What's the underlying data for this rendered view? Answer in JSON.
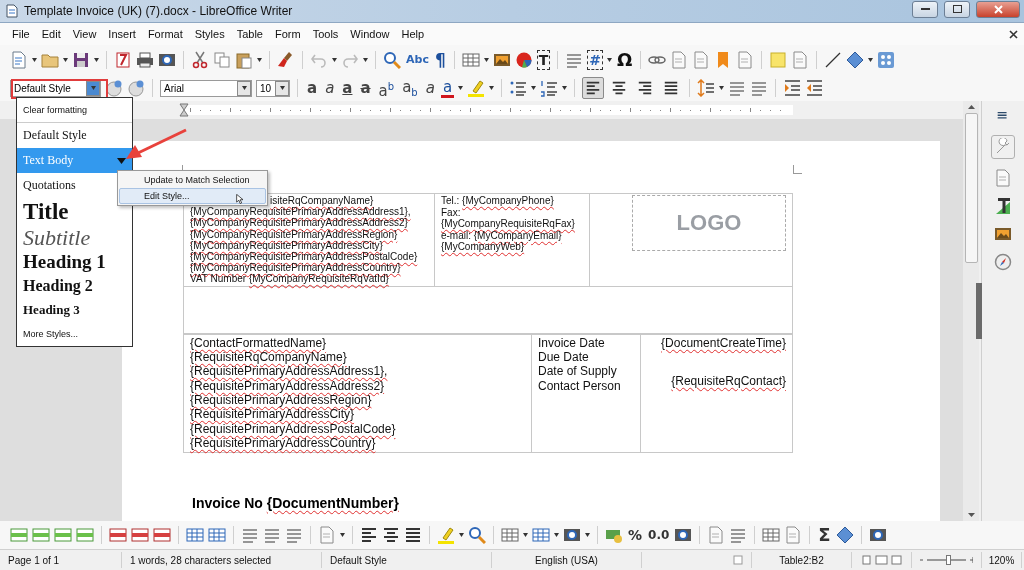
{
  "window": {
    "title": "Template Invoice (UK) (7).docx - LibreOffice Writer"
  },
  "menu": [
    "File",
    "Edit",
    "View",
    "Insert",
    "Format",
    "Styles",
    "Table",
    "Form",
    "Tools",
    "Window",
    "Help"
  ],
  "toolbar_glyphs": [
    "Abc",
    "¶",
    "T",
    "#",
    "Ω"
  ],
  "formatting": {
    "style": "Default Style",
    "style_open": true,
    "font": "Arial",
    "size": "10"
  },
  "format_buttons": [
    {
      "kind": "bold",
      "glyph": "a"
    },
    {
      "kind": "italic",
      "glyph": "a"
    },
    {
      "kind": "underline",
      "glyph": "a"
    },
    {
      "kind": "strike",
      "glyph": "a"
    },
    {
      "kind": "script",
      "glyph": "a$^{b}$"
    },
    {
      "kind": "script",
      "glyph": "a$_{b}$"
    },
    {
      "kind": "clear",
      "glyph": "a"
    },
    {
      "kind": "color",
      "glyph": "a"
    }
  ],
  "align_buttons": [
    {
      "kind": "left",
      "selected": true
    },
    {
      "kind": "center",
      "selected": false
    },
    {
      "kind": "right",
      "selected": false
    },
    {
      "kind": "justify",
      "selected": false
    }
  ],
  "styles_menu": [
    {
      "label": "Clear formatting",
      "kind": "action",
      "selected": false
    },
    {
      "label": "Default Style",
      "kind": "plain",
      "selected": false
    },
    {
      "label": "Text Body",
      "kind": "plain",
      "selected": true
    },
    {
      "label": "Quotations",
      "kind": "plain",
      "selected": false
    },
    {
      "label": "Title",
      "kind": "title",
      "selected": false
    },
    {
      "label": "Subtitle",
      "kind": "subtitle",
      "selected": false
    },
    {
      "label": "Heading 1",
      "kind": "h1",
      "selected": false
    },
    {
      "label": "Heading 2",
      "kind": "h2",
      "selected": false
    },
    {
      "label": "Heading 3",
      "kind": "h3",
      "selected": false
    },
    {
      "label": "More Styles...",
      "kind": "action",
      "selected": false
    }
  ],
  "context_menu": [
    {
      "label": "Update to Match Selection",
      "selected": false
    },
    {
      "label": "Edit Style...",
      "selected": true
    }
  ],
  "document": {
    "company_lines": [
      {
        "field": "isiteRqCompanyName}",
        "kind": "partial"
      },
      {
        "field": "{MyCompanyRequisitePrimaryAddressAddress1},"
      },
      {
        "field": "{MyCompanyRequisitePrimaryAddressAddress2}"
      },
      {
        "field": "{MyCompanyRequisitePrimaryAddressRegion}"
      },
      {
        "field": "{MyCompanyRequisitePrimaryAddressCity}"
      },
      {
        "field": "{MyCompanyRequisitePrimaryAddressPostalCode}"
      },
      {
        "field": "{MyCompanyRequisitePrimaryAddressCountry}"
      },
      {
        "label": "VAT Number ",
        "field": "{MyCompanyRequisiteRqVatId}"
      }
    ],
    "contact_lines": [
      {
        "label": "Tel.: ",
        "field": "{MyCompanyPhone}"
      },
      {
        "label": "Fax:"
      },
      {
        "field": "{MyCompanyRequisiteRqFax}"
      },
      {
        "label": "e-mail: ",
        "field": "{MyCompanyEmail}"
      },
      {
        "field": "{MyCompanyWeb}"
      }
    ],
    "logo": "LOGO",
    "client_lines": [
      {
        "field": "{ContactFormattedName}"
      },
      {
        "field": "{RequisiteRqCompanyName}"
      },
      {
        "field": "{RequisitePrimaryAddressAddress1},"
      },
      {
        "field": "{RequisitePrimaryAddressAddress2}"
      },
      {
        "field": "{RequisitePrimaryAddressRegion}"
      },
      {
        "field": "{RequisitePrimaryAddressCity}"
      },
      {
        "field": "{RequisitePrimaryAddressPostalCode}"
      },
      {
        "field": "{RequisitePrimaryAddressCountry}"
      }
    ],
    "date_rows": [
      {
        "label": "Invoice Date",
        "field": "{DocumentCreateTime}"
      },
      {
        "label": "Due Date"
      },
      {
        "label": "Date of Supply"
      },
      {
        "label": "Contact Person",
        "field": "{RequisiteRqContact}"
      }
    ],
    "invoice_heading": {
      "label": "Invoice No ",
      "field": "{DocumentNumber}"
    }
  },
  "bottom_glyphs": [
    "%",
    "0.0",
    "Σ"
  ],
  "status_bar": {
    "page": "Page 1 of 1",
    "selection": "1 words, 28 characters selected",
    "style": "Default Style",
    "language": "English (USA)",
    "cell": "Table2:B2",
    "zoom": {
      "level": 0.55
    },
    "zoom_percent": "120%"
  }
}
